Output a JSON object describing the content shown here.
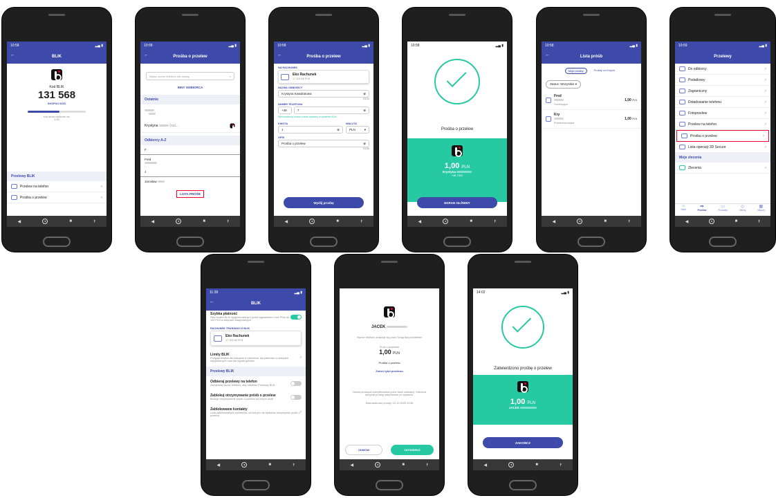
{
  "p1": {
    "time": "10:58",
    "title": "BLIK",
    "code_label": "Kod BLIK",
    "code": "131 568",
    "copy": "SKOPIUJ KOD",
    "valid_label": "Kod straci ważność za:",
    "valid_time": "1:20",
    "section": "Przelewy BLIK",
    "item1": "Przelew na telefon",
    "item2": "Prośba o przelew"
  },
  "p2": {
    "time": "10:58",
    "title": "Prośba o przelew",
    "search_placeholder": "Wpisz numer telefonu lub nazwę",
    "other": "INNY ODBIORCA",
    "recent": "Ostatnie",
    "contact1": "Krystyna",
    "contact1_hint": "(nat...",
    "az": "Odbiorcy A-Z",
    "l1": "F",
    "c2": "Fred",
    "l2": "J",
    "c3": "Jarosław",
    "list": "LISTA PRÓŚB"
  },
  "p3": {
    "time": "10:58",
    "title": "Prośba o przelew",
    "acc_label": "NA RACHUNEK",
    "acc_name": "Eko Rachunek",
    "acc_bal": "17 101,96 PLN",
    "name_label": "NAZWA ODBIORCY",
    "name_val": "Krystyna Kwadratowa",
    "name_count": "18/33",
    "phone_label": "NUMER TELEFONU",
    "prefix": "+48",
    "phone_val": "7",
    "phone_hint": "Wprowadzony numer został zapisany w systemie BLIK",
    "amount_label": "KWOTA",
    "amount": "1",
    "cur_label": "WALUTA",
    "cur": "PLN",
    "desc_label": "OPIS",
    "desc": "Prośba o przelew",
    "desc_count": "16/35",
    "btn": "Wyślij prośbę"
  },
  "p4": {
    "time": "10:58",
    "text": "Prośba o przelew",
    "amount": "1,00",
    "cur": "PLN",
    "name": "Krystyna",
    "phone": "+48 7322",
    "btn": "EKRAN GŁÓWNY"
  },
  "p5": {
    "time": "10:58",
    "title": "Lista próśb",
    "tab1": "Moje prośby",
    "tab2": "Prośby od innych",
    "status": "Status: Wszystkie",
    "r1_name": "Fred",
    "r1_status": "Oczekujące",
    "r1_amt": "1,00",
    "r2_name": "Kry",
    "r2_status": "Przeterminowane",
    "r2_amt": "1,00",
    "cur": "PLN"
  },
  "p6": {
    "time": "10:59",
    "title": "Przelewy",
    "items": [
      "Do odbiorcy",
      "Podatkowy",
      "Zagraniczny",
      "Doładowanie telefonu",
      "Fotoprzelew",
      "Przelew na telefon",
      "Prośba o przelew",
      "Lista operacji 3D Secure"
    ],
    "section": "Moje zlecenia",
    "orders": "Zlecenia",
    "tabs": [
      "Start",
      "Przelew",
      "Produkty",
      "Oferty",
      "Więcej"
    ]
  },
  "p7": {
    "time": "11:38",
    "title": "BLIK",
    "quick_title": "Szybka płatność",
    "quick_desc": "Płać kodem BLIK wygenerowanym przed logowaniem i bez PINu do 100 PLN w sklepach stacjonarnych.",
    "acc_label": "RACHUNEK TRANSAKCJI BLIK",
    "acc_name": "Eko Rachunek",
    "acc_bal": "17 100,96 PLN",
    "limits_title": "Limity BLIK",
    "limits_desc": "Podgląd limitów dla zakupów w internecie, dla płatności w sklepach stacjonarnych oraz dla wypłat gotówki.",
    "section": "Przelewy BLIK",
    "t1": "Odbieraj przelewy na telefon",
    "t1d": "Zarejestruj numer telefonu, aby odbierać Przelewy BLIK",
    "t2": "Zablokuj otrzymywanie próśb o przelew",
    "t2d": "Blokuje otrzymywanie próśb o przelew od innych osób",
    "t3": "Zablokowane kontakty",
    "t3d": "Lista zablokowanych kontaktów, od których nie będziesz otrzymywać próśb o przelew."
  },
  "p8": {
    "name": "JACEK",
    "info": "Numer telefonu znajduje się poza Twoją listą kontaktów",
    "req_label": "Prośi o przelanie",
    "amount": "1,00",
    "cur": "PLN",
    "desc": "Prośba o przelew",
    "change": "Zmień tytuł przelewu",
    "verify": "Osoba prosząca zweryfikowana przez bank nadawcy. Odbiorca otrzymał prośbę natychmiast po wysłaniu.",
    "date": "Data ważności prośby: 22.12.2025 10:58",
    "reject": "ODMÓW",
    "accept": "ZATWIERDŹ"
  },
  "p9": {
    "time": "14:02",
    "text": "Zatwierdzono prośbę o przelew",
    "amount": "1,00",
    "cur": "PLN",
    "name": "JACEK",
    "btn": "ZAKOŃCZ"
  },
  "nav_icons": [
    "back-triangle-icon",
    "home-circle-icon",
    "recent-square-icon",
    "accessibility-icon"
  ]
}
